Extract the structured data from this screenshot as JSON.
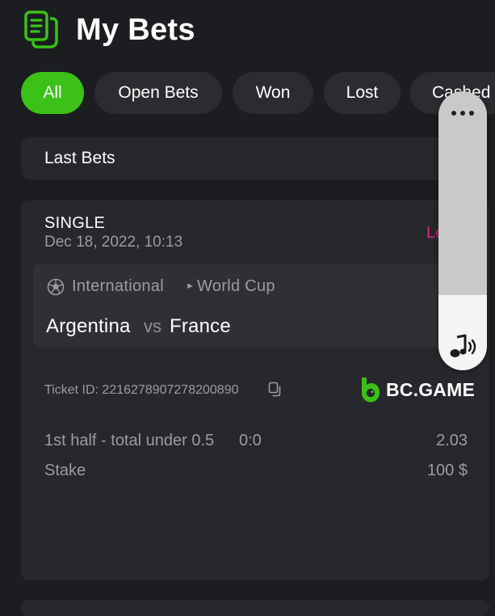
{
  "header": {
    "title": "My Bets",
    "icon": "receipt-icon"
  },
  "tabs": [
    {
      "label": "All",
      "active": true
    },
    {
      "label": "Open Bets",
      "active": false
    },
    {
      "label": "Won",
      "active": false
    },
    {
      "label": "Lost",
      "active": false
    },
    {
      "label": "Cashed out",
      "active": false
    }
  ],
  "section": {
    "title": "Last Bets"
  },
  "bet": {
    "type": "SINGLE",
    "date": "Dec 18, 2022, 10:13",
    "status": "Lost",
    "league": {
      "category": "International",
      "competition": "World Cup"
    },
    "match": {
      "home": "Argentina",
      "vs": "vs",
      "away": "France"
    },
    "ticket_id": "Ticket ID: 2216278907278200890",
    "brand": "BC.GAME",
    "selection": "1st half - total under 0.5",
    "selection_score": "0:0",
    "odds": "2.03",
    "stake_label": "Stake",
    "stake_value": "100 $"
  },
  "volume_overlay": {
    "level": 0.27,
    "icons": [
      "more-icon",
      "music-note-icon"
    ]
  },
  "colors": {
    "accent": "#3bc117",
    "lost": "#e0217a",
    "background": "#1b1d20",
    "card": "#26282c"
  }
}
